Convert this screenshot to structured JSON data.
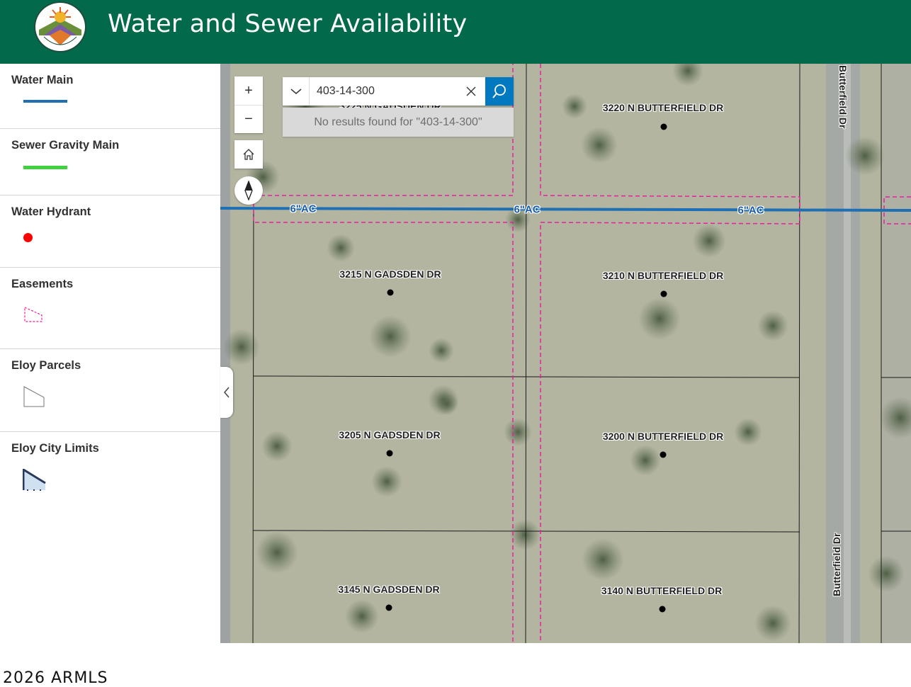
{
  "header": {
    "title": "Water and Sewer Availability",
    "logo_text": "ELOY, ARIZONA"
  },
  "legend": {
    "items": [
      {
        "label": "Water Main",
        "color": "#1f6fb5",
        "symbol": "line"
      },
      {
        "label": "Sewer Gravity Main",
        "color": "#3ed23e",
        "symbol": "line"
      },
      {
        "label": "Water Hydrant",
        "color": "#ff0000",
        "symbol": "point"
      },
      {
        "label": "Easements",
        "color": "#e8209e",
        "symbol": "dashed-polygon"
      },
      {
        "label": "Eloy Parcels",
        "color": "#555555",
        "symbol": "polygon"
      },
      {
        "label": "Eloy City Limits",
        "color": "#2a3a5a",
        "symbol": "polygon-outline"
      }
    ]
  },
  "attribution": "2026 ARMLS",
  "map": {
    "controls": {
      "zoom_in": "+",
      "zoom_out": "−"
    },
    "search": {
      "value": "403-14-300",
      "no_results": "No results found for \"403-14-300\""
    },
    "water_main_labels": [
      "6\"AC",
      "6\"AC",
      "6\"AC"
    ],
    "streets": [
      "Butterfield Dr",
      "Butterfield Dr"
    ],
    "addresses": [
      "3225 N GADSDEN DR",
      "3220 N BUTTERFIELD DR",
      "3215 N GADSDEN DR",
      "3210 N BUTTERFIELD DR",
      "3205 N GADSDEN DR",
      "3200 N BUTTERFIELD DR",
      "3145 N GADSDEN DR",
      "3140 N BUTTERFIELD DR"
    ]
  }
}
